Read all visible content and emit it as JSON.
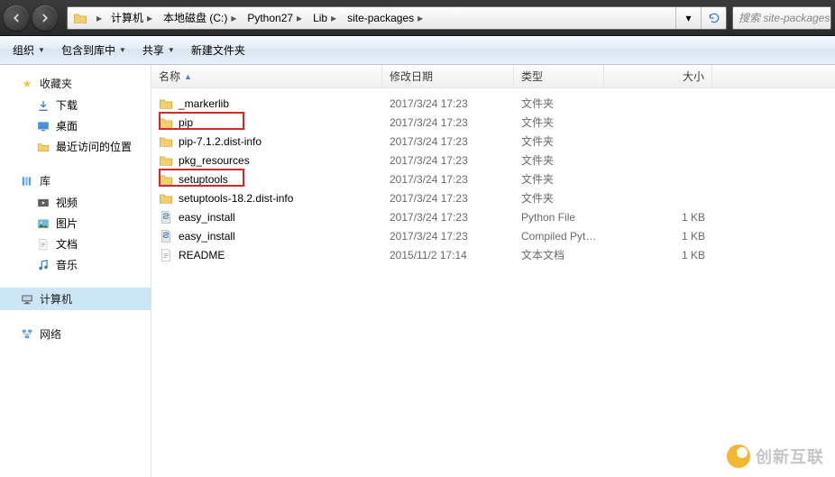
{
  "breadcrumbs": [
    "计算机",
    "本地磁盘 (C:)",
    "Python27",
    "Lib",
    "site-packages"
  ],
  "search": {
    "placeholder": "搜索 site-packages"
  },
  "toolbar": {
    "organize": "组织",
    "include": "包含到库中",
    "share": "共享",
    "newfolder": "新建文件夹"
  },
  "sidebar": {
    "favorites": {
      "title": "收藏夹",
      "items": [
        "下载",
        "桌面",
        "最近访问的位置"
      ]
    },
    "libraries": {
      "title": "库",
      "items": [
        "视频",
        "图片",
        "文档",
        "音乐"
      ]
    },
    "computer": {
      "title": "计算机"
    },
    "network": {
      "title": "网络"
    }
  },
  "columns": {
    "name": "名称",
    "date": "修改日期",
    "type": "类型",
    "size": "大小"
  },
  "rows": [
    {
      "name": "_markerlib",
      "date": "2017/3/24 17:23",
      "type": "文件夹",
      "size": "",
      "icon": "folder"
    },
    {
      "name": "pip",
      "date": "2017/3/24 17:23",
      "type": "文件夹",
      "size": "",
      "icon": "folder",
      "highlight": true
    },
    {
      "name": "pip-7.1.2.dist-info",
      "date": "2017/3/24 17:23",
      "type": "文件夹",
      "size": "",
      "icon": "folder"
    },
    {
      "name": "pkg_resources",
      "date": "2017/3/24 17:23",
      "type": "文件夹",
      "size": "",
      "icon": "folder"
    },
    {
      "name": "setuptools",
      "date": "2017/3/24 17:23",
      "type": "文件夹",
      "size": "",
      "icon": "folder",
      "highlight": true
    },
    {
      "name": "setuptools-18.2.dist-info",
      "date": "2017/3/24 17:23",
      "type": "文件夹",
      "size": "",
      "icon": "folder"
    },
    {
      "name": "easy_install",
      "date": "2017/3/24 17:23",
      "type": "Python File",
      "size": "1 KB",
      "icon": "python"
    },
    {
      "name": "easy_install",
      "date": "2017/3/24 17:23",
      "type": "Compiled Pytho...",
      "size": "1 KB",
      "icon": "python"
    },
    {
      "name": "README",
      "date": "2015/11/2 17:14",
      "type": "文本文档",
      "size": "1 KB",
      "icon": "text"
    }
  ],
  "watermark": "创新互联"
}
